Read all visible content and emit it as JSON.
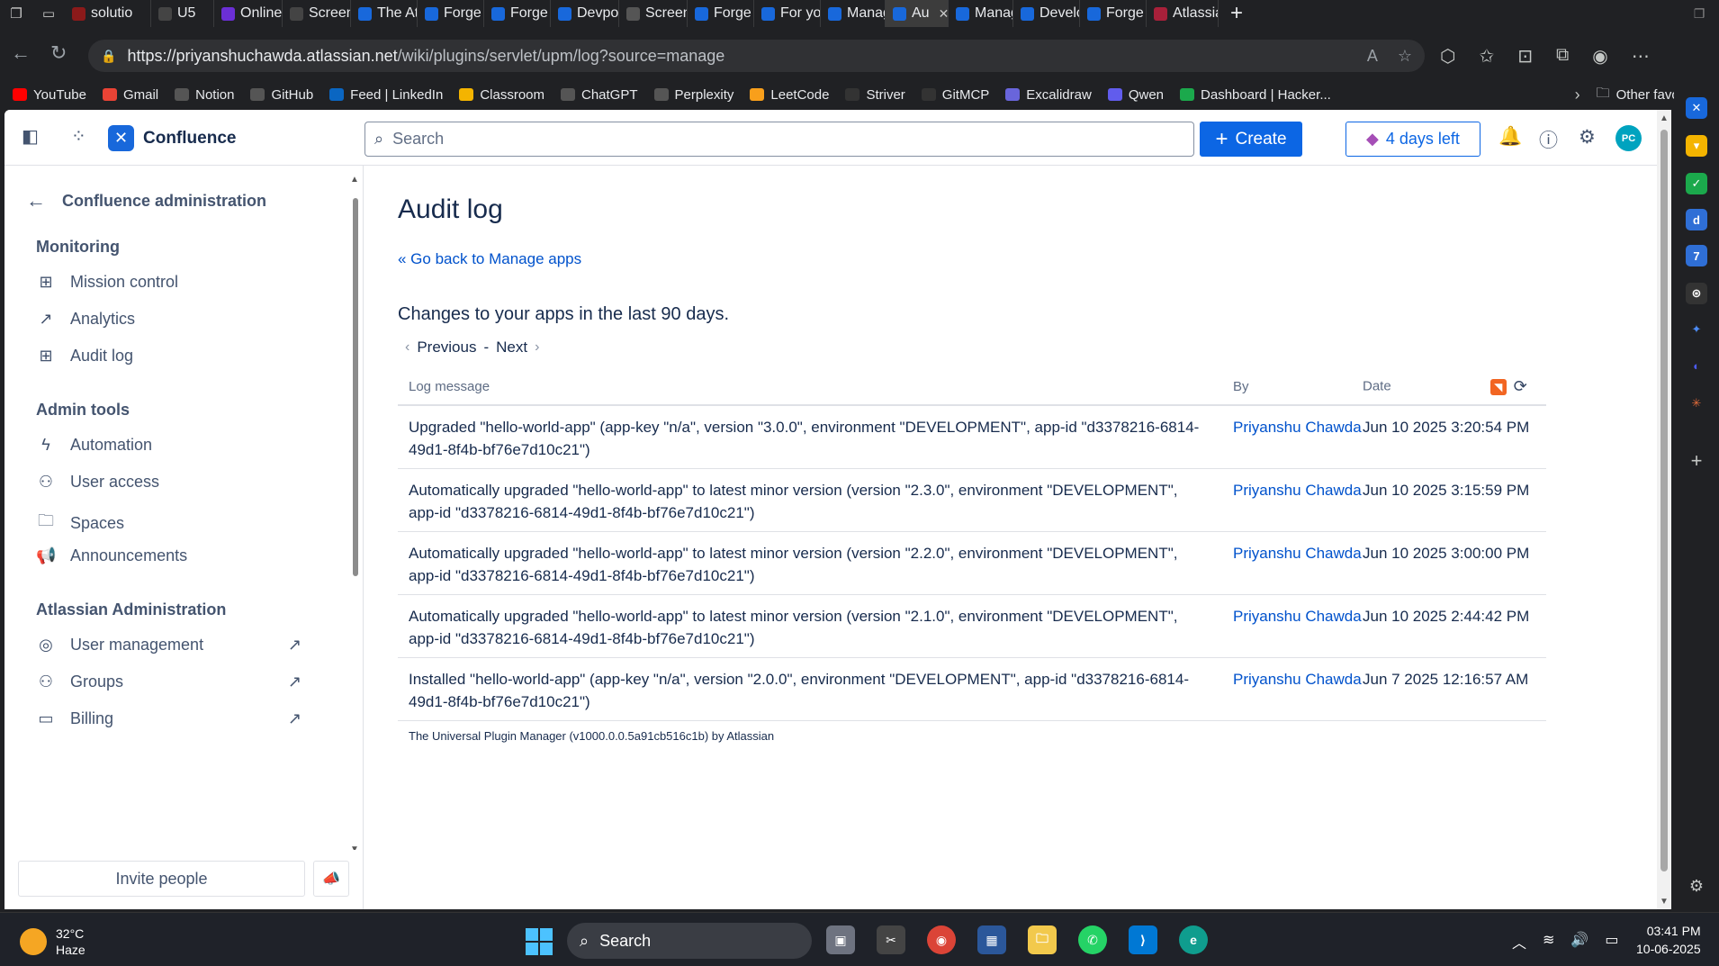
{
  "browser": {
    "tabs": [
      {
        "label": "solutio",
        "color": "#8b1a1a"
      },
      {
        "label": "U5",
        "color": "#444"
      },
      {
        "label": "Online",
        "color": "#6b2fd6"
      },
      {
        "label": "Screen",
        "color": "#444"
      },
      {
        "label": "The At",
        "color": "#1868db"
      },
      {
        "label": "Forge",
        "color": "#1868db"
      },
      {
        "label": "Forge",
        "color": "#1868db"
      },
      {
        "label": "Devpo",
        "color": "#1868db"
      },
      {
        "label": "Screen",
        "color": "#555"
      },
      {
        "label": "Forge",
        "color": "#1868db"
      },
      {
        "label": "For you",
        "color": "#1868db"
      },
      {
        "label": "Manag",
        "color": "#1868db"
      },
      {
        "label": "Au",
        "color": "#1868db",
        "active": true
      },
      {
        "label": "Manag",
        "color": "#1868db"
      },
      {
        "label": "Develo",
        "color": "#1868db"
      },
      {
        "label": "Forge",
        "color": "#1868db"
      },
      {
        "label": "Atlassia",
        "color": "#a8203a"
      }
    ],
    "url_host": "https://priyanshuchawda.atlassian.net",
    "url_path": "/wiki/plugins/servlet/upm/log?source=manage",
    "bookmarks": [
      {
        "label": "YouTube",
        "color": "#ff0000"
      },
      {
        "label": "Gmail",
        "color": "#ea4335"
      },
      {
        "label": "Notion",
        "color": "#555"
      },
      {
        "label": "GitHub",
        "color": "#555"
      },
      {
        "label": "Feed | LinkedIn",
        "color": "#0a66c2"
      },
      {
        "label": "Classroom",
        "color": "#f4b400"
      },
      {
        "label": "ChatGPT",
        "color": "#555"
      },
      {
        "label": "Perplexity",
        "color": "#555"
      },
      {
        "label": "LeetCode",
        "color": "#f89f1b"
      },
      {
        "label": "Striver",
        "color": "#333"
      },
      {
        "label": "GitMCP",
        "color": "#333"
      },
      {
        "label": "Excalidraw",
        "color": "#6965db"
      },
      {
        "label": "Qwen",
        "color": "#615ced"
      },
      {
        "label": "Dashboard | Hacker...",
        "color": "#1ba94c"
      }
    ],
    "other_favorites": "Other favorites"
  },
  "header": {
    "app_name": "Confluence",
    "search_placeholder": "Search",
    "create_label": "Create",
    "trial_label": "4 days left",
    "avatar_initials": "PC"
  },
  "sidebar": {
    "back_title": "Confluence administration",
    "sections": [
      {
        "title": "Monitoring",
        "items": [
          {
            "label": "Mission control",
            "icon": "grid-icon"
          },
          {
            "label": "Analytics",
            "icon": "chart-icon"
          },
          {
            "label": "Audit log",
            "icon": "table-icon"
          }
        ]
      },
      {
        "title": "Admin tools",
        "items": [
          {
            "label": "Automation",
            "icon": "lightning-icon"
          },
          {
            "label": "User access",
            "icon": "user-check-icon"
          },
          {
            "label": "Spaces",
            "icon": "folder-icon"
          },
          {
            "label": "Announcements",
            "icon": "megaphone-icon"
          }
        ]
      },
      {
        "title": "Atlassian Administration",
        "items": [
          {
            "label": "User management",
            "icon": "person-icon",
            "external": true
          },
          {
            "label": "Groups",
            "icon": "people-icon",
            "external": true
          },
          {
            "label": "Billing",
            "icon": "card-icon",
            "external": true
          }
        ]
      }
    ],
    "invite_label": "Invite people"
  },
  "main": {
    "title": "Audit log",
    "back_link": "« Go back to Manage apps",
    "subtitle": "Changes to your apps in the last 90 days.",
    "pager": {
      "previous": "Previous",
      "separator": "-",
      "next": "Next"
    },
    "columns": [
      "Log message",
      "By",
      "Date"
    ],
    "rows": [
      {
        "message": "Upgraded \"hello-world-app\" (app-key \"n/a\", version \"3.0.0\", environment \"DEVELOPMENT\", app-id \"d3378216-6814-49d1-8f4b-bf76e7d10c21\")",
        "by": "Priyanshu Chawda",
        "date": "Jun 10 2025 3:20:54 PM"
      },
      {
        "message": "Automatically upgraded \"hello-world-app\" to latest minor version (version \"2.3.0\", environment \"DEVELOPMENT\", app-id \"d3378216-6814-49d1-8f4b-bf76e7d10c21\")",
        "by": "Priyanshu Chawda",
        "date": "Jun 10 2025 3:15:59 PM"
      },
      {
        "message": "Automatically upgraded \"hello-world-app\" to latest minor version (version \"2.2.0\", environment \"DEVELOPMENT\", app-id \"d3378216-6814-49d1-8f4b-bf76e7d10c21\")",
        "by": "Priyanshu Chawda",
        "date": "Jun 10 2025 3:00:00 PM"
      },
      {
        "message": "Automatically upgraded \"hello-world-app\" to latest minor version (version \"2.1.0\", environment \"DEVELOPMENT\", app-id \"d3378216-6814-49d1-8f4b-bf76e7d10c21\")",
        "by": "Priyanshu Chawda",
        "date": "Jun 10 2025 2:44:42 PM"
      },
      {
        "message": "Installed \"hello-world-app\" (app-key \"n/a\", version \"2.0.0\", environment \"DEVELOPMENT\", app-id \"d3378216-6814-49d1-8f4b-bf76e7d10c21\")",
        "by": "Priyanshu Chawda",
        "date": "Jun 7 2025 12:16:57 AM"
      }
    ],
    "footer": "The Universal Plugin Manager (v1000.0.0.5a91cb516c1b) by Atlassian"
  },
  "taskbar": {
    "temperature": "32°C",
    "weather": "Haze",
    "search_label": "Search",
    "time": "03:41 PM",
    "date": "10-06-2025"
  }
}
